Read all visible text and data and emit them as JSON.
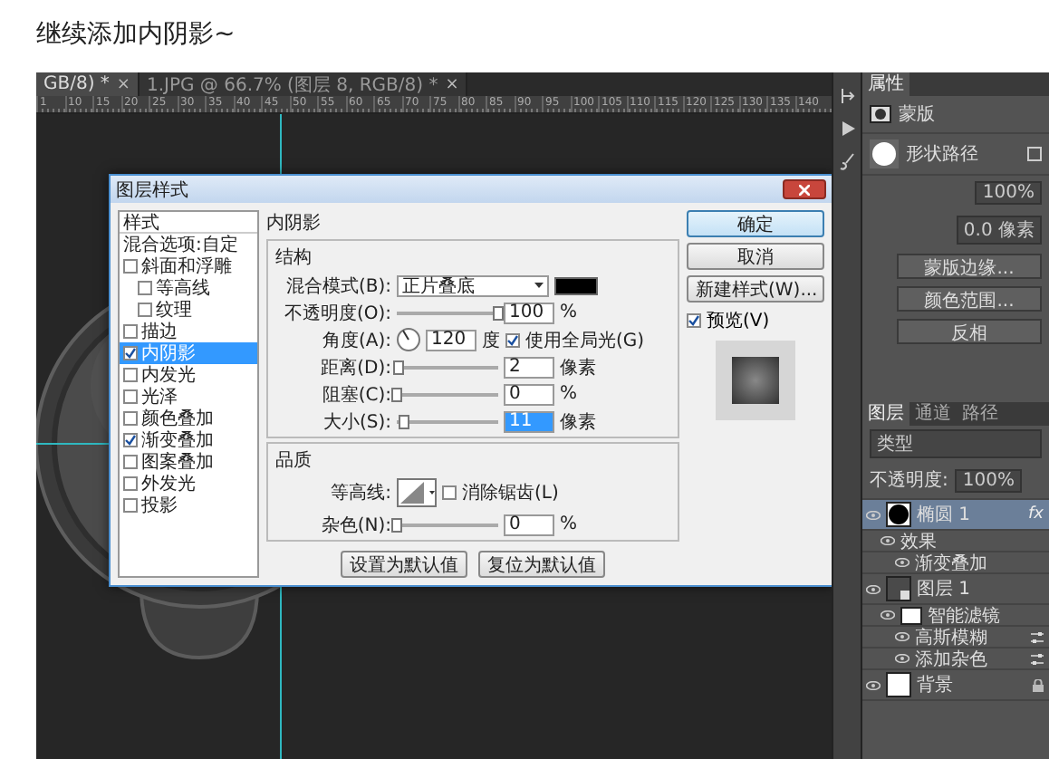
{
  "heading": "继续添加内阴影~",
  "doc_tabs": [
    {
      "label": "GB/8) *",
      "close": "×",
      "selected": true
    },
    {
      "label": "1.JPG @ 66.7% (图层 8, RGB/8) *",
      "close": "×",
      "selected": false
    }
  ],
  "ruler": [
    "1",
    "10",
    "15",
    "20",
    "25",
    "30",
    "35",
    "40",
    "45",
    "50",
    "55",
    "60",
    "65",
    "70",
    "75",
    "80",
    "85",
    "90",
    "95",
    "100",
    "105",
    "110",
    "115",
    "120",
    "125",
    "130",
    "135",
    "140"
  ],
  "dialog": {
    "title": "图层样式",
    "styles": [
      {
        "kind": "header",
        "label": "样式",
        "selected": false
      },
      {
        "kind": "plain",
        "label": "混合选项:自定",
        "selected": false
      },
      {
        "kind": "check",
        "label": "斜面和浮雕",
        "checked": false,
        "selected": false,
        "children": [
          {
            "kind": "check",
            "label": "等高线",
            "checked": false,
            "selected": false
          },
          {
            "kind": "check",
            "label": "纹理",
            "checked": false,
            "selected": false
          }
        ]
      },
      {
        "kind": "check",
        "label": "描边",
        "checked": false,
        "selected": false
      },
      {
        "kind": "check",
        "label": "内阴影",
        "checked": true,
        "selected": true
      },
      {
        "kind": "check",
        "label": "内发光",
        "checked": false,
        "selected": false
      },
      {
        "kind": "check",
        "label": "光泽",
        "checked": false,
        "selected": false
      },
      {
        "kind": "check",
        "label": "颜色叠加",
        "checked": false,
        "selected": false
      },
      {
        "kind": "check",
        "label": "渐变叠加",
        "checked": true,
        "selected": false
      },
      {
        "kind": "check",
        "label": "图案叠加",
        "checked": false,
        "selected": false
      },
      {
        "kind": "check",
        "label": "外发光",
        "checked": false,
        "selected": false
      },
      {
        "kind": "check",
        "label": "投影",
        "checked": false,
        "selected": false
      }
    ],
    "section": "内阴影",
    "structure": {
      "title": "结构",
      "rows": [
        {
          "kind": "blend",
          "label": "混合模式(B):",
          "value": "正片叠底",
          "color": "#000000"
        },
        {
          "kind": "slider",
          "label": "不透明度(O):",
          "level": 1,
          "value": "100",
          "unit": "%",
          "selected": false
        },
        {
          "kind": "angle",
          "label": "角度(A):",
          "value": "120",
          "unit": "度",
          "option": {
            "label": "使用全局光(G)",
            "checked": true
          }
        },
        {
          "kind": "slider",
          "label": "距离(D):",
          "level": 0.02,
          "value": "2",
          "unit": "像素",
          "selected": false
        },
        {
          "kind": "slider",
          "label": "阻塞(C):",
          "level": 0,
          "value": "0",
          "unit": "%",
          "selected": false
        },
        {
          "kind": "slider",
          "label": "大小(S):",
          "level": 0.08,
          "value": "11",
          "unit": "像素",
          "selected": true
        }
      ]
    },
    "quality": {
      "title": "品质",
      "rows": [
        {
          "kind": "contour",
          "label": "等高线:",
          "option": {
            "label": "消除锯齿(L)",
            "checked": false
          }
        },
        {
          "kind": "slider",
          "label": "杂色(N):",
          "level": 0,
          "value": "0",
          "unit": "%",
          "selected": false
        }
      ]
    },
    "defaults": [
      "设置为默认值",
      "复位为默认值"
    ],
    "actions": [
      {
        "label": "确定",
        "primary": true
      },
      {
        "label": "取消",
        "primary": false
      },
      {
        "label": "新建样式(W)...",
        "primary": false
      }
    ],
    "preview": {
      "label": "预览(V)",
      "checked": true
    }
  },
  "properties": {
    "tab": "属性",
    "mask": "蒙版",
    "path": "形状路径",
    "density": "100%",
    "feather": "0.0 像素",
    "buttons": [
      "蒙版边缘...",
      "颜色范围...",
      "反相"
    ]
  },
  "layers": {
    "tabs": [
      {
        "label": "图层",
        "selected": true
      },
      {
        "label": "通道",
        "selected": false
      },
      {
        "label": "路径",
        "selected": false
      }
    ],
    "filter": "类型",
    "opacity_label": "不透明度:",
    "opacity": "100%",
    "items": [
      {
        "kind": "shape",
        "label": "椭圆 1",
        "badge": "fx",
        "selected": true,
        "children": [
          {
            "kind": "effects",
            "label": "效果",
            "selected": false,
            "children": [
              {
                "kind": "effect",
                "label": "渐变叠加",
                "selected": false
              }
            ]
          }
        ]
      },
      {
        "kind": "smart",
        "label": "图层 1",
        "selected": false,
        "children": [
          {
            "kind": "filters",
            "label": "智能滤镜",
            "selected": false,
            "children": [
              {
                "kind": "filter",
                "label": "高斯模糊",
                "selected": false
              },
              {
                "kind": "filter",
                "label": "添加杂色",
                "selected": false
              }
            ]
          }
        ]
      },
      {
        "kind": "background",
        "label": "背景",
        "locked": true,
        "selected": false
      }
    ]
  }
}
